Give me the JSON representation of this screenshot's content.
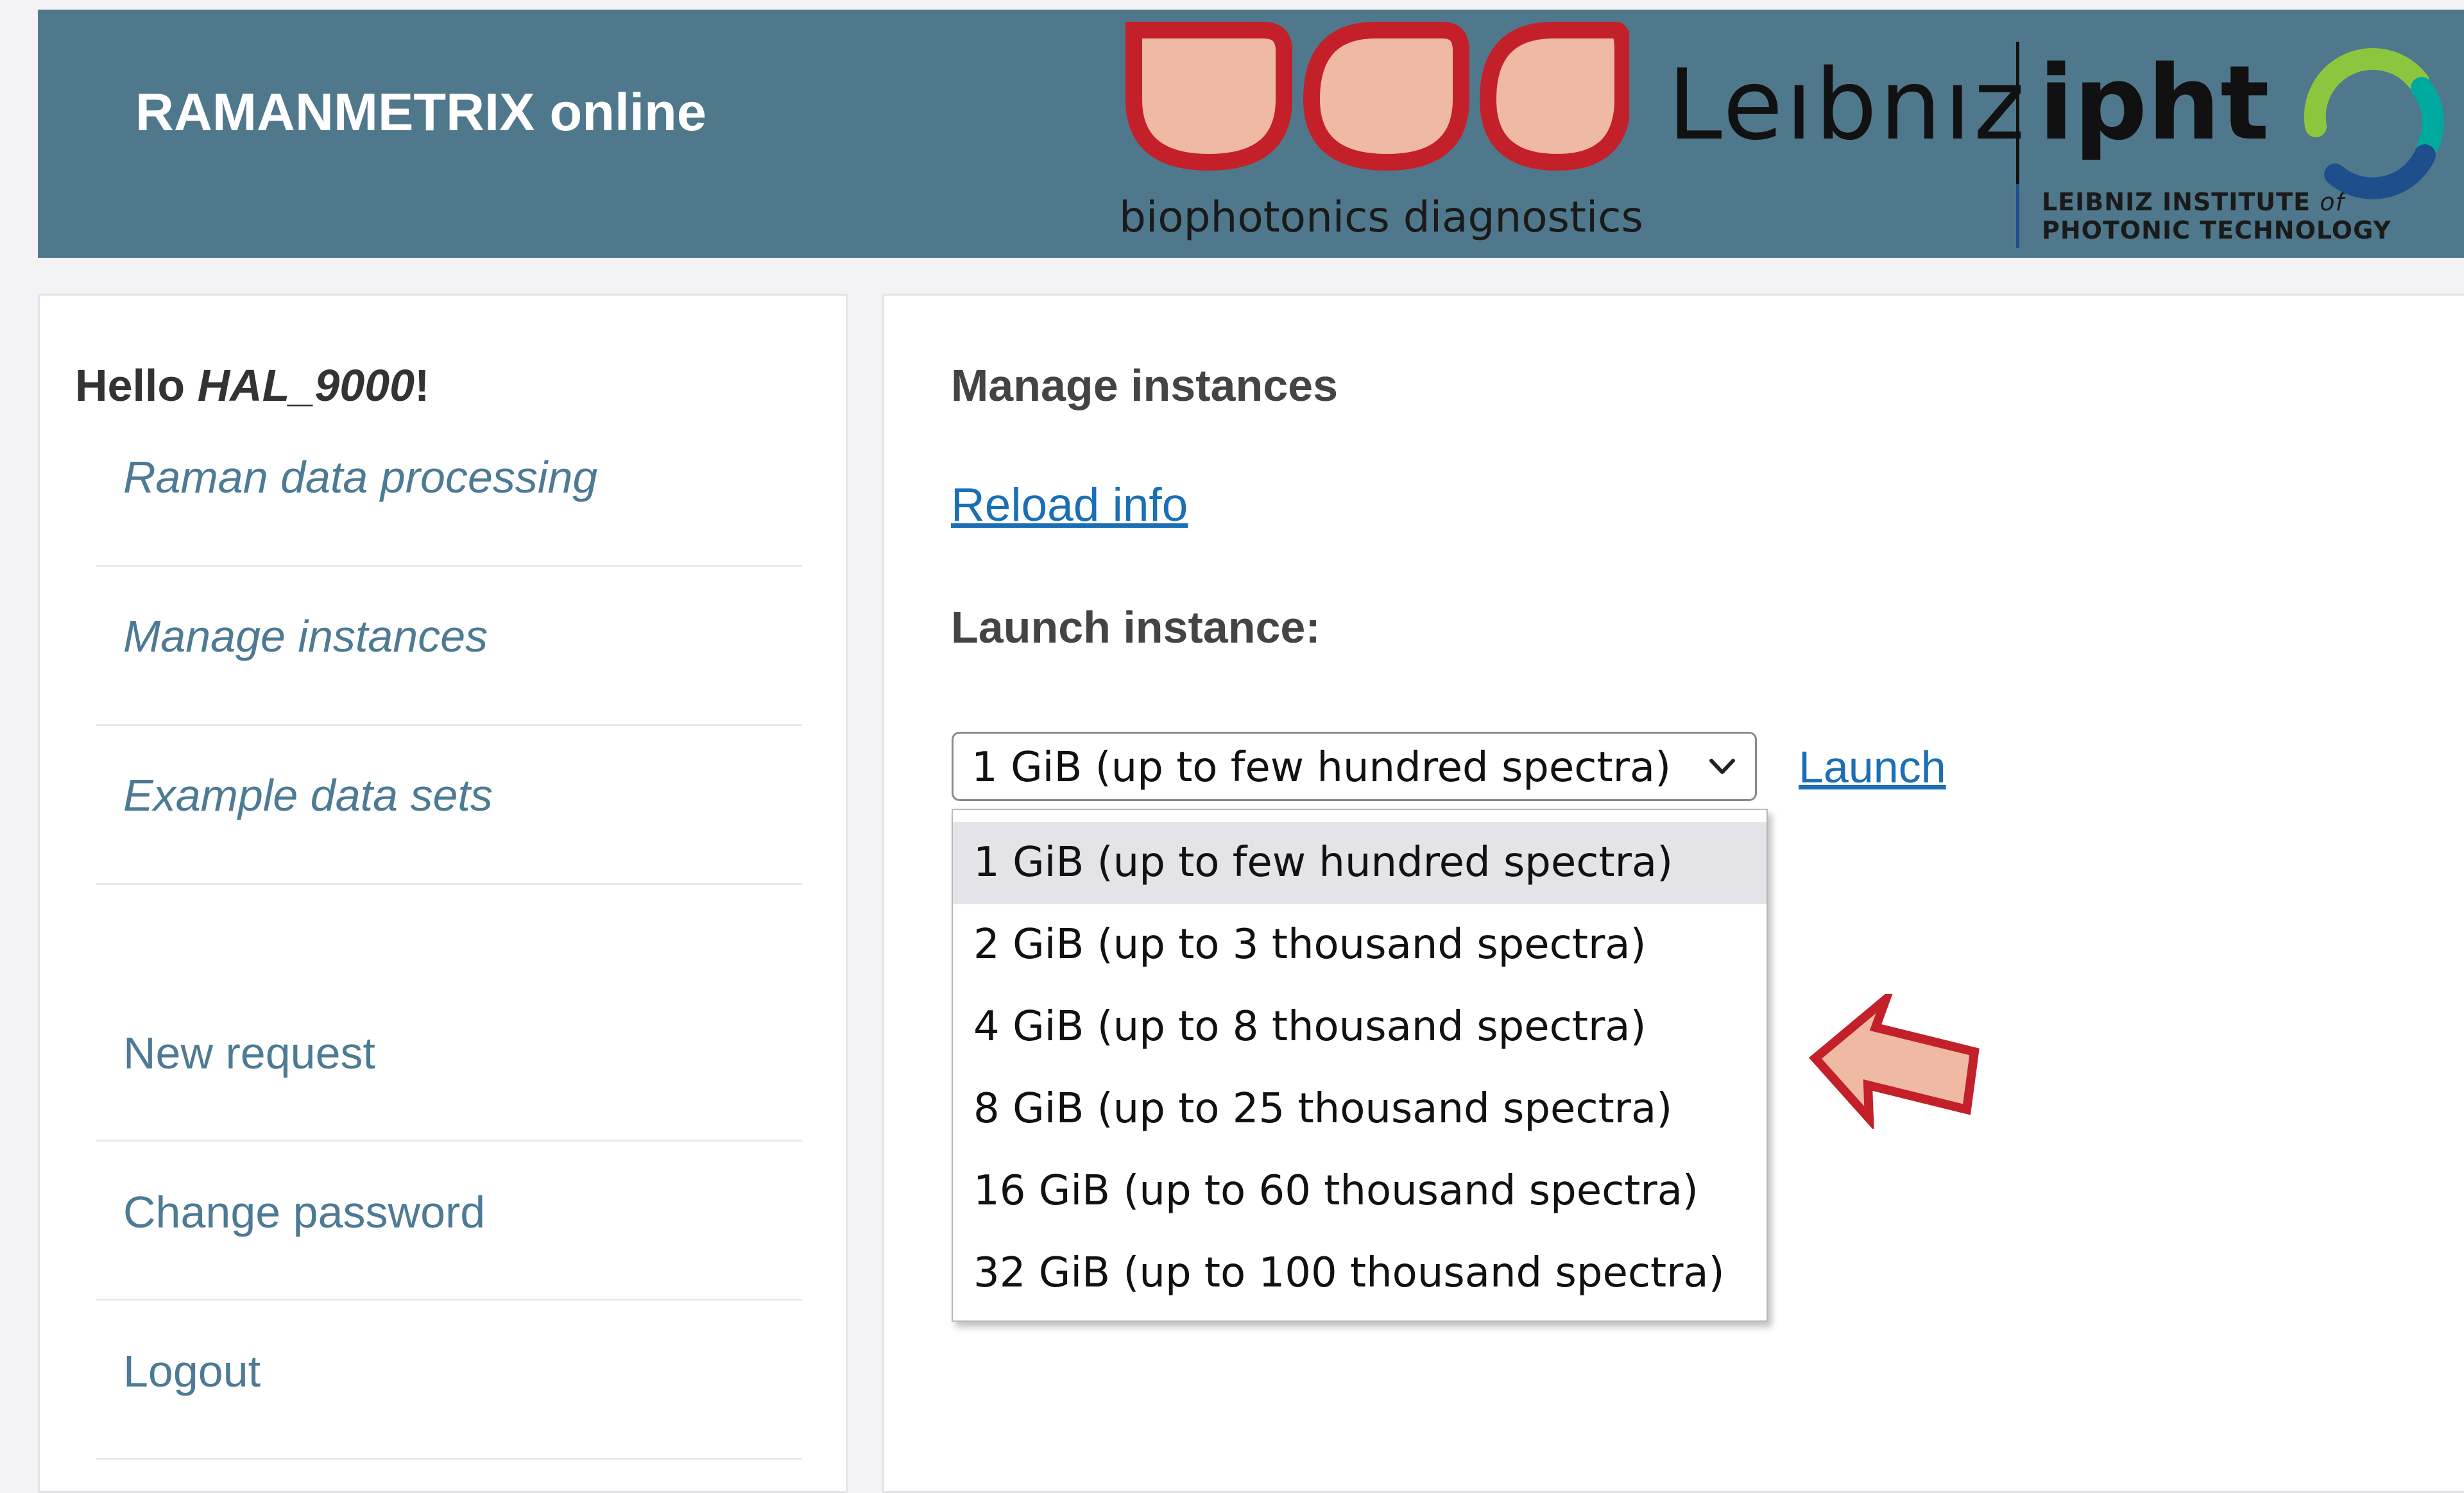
{
  "header": {
    "brand_bold": "RAMANMETRIX",
    "brand_rest": " online",
    "bpd_caption": "biophotonics diagnostics",
    "leibniz": "Leıbnız",
    "ipht": "ipht",
    "ipht_sub_line1a": "LEIBNIZ INSTITUTE ",
    "ipht_sub_of": "of",
    "ipht_sub_line2": "PHOTONIC TECHNOLOGY",
    "colors": {
      "bar": "#50788c",
      "bpd_red": "#c3202a",
      "bpd_fill": "#f0b9a4"
    }
  },
  "sidebar": {
    "hello_prefix": "Hello ",
    "hello_user": "HAL_9000",
    "hello_suffix": "!",
    "items": [
      {
        "label": "Raman data processing"
      },
      {
        "label": "Manage instances"
      },
      {
        "label": "Example data sets"
      },
      {
        "label": "New request"
      },
      {
        "label": "Change password"
      },
      {
        "label": "Logout"
      }
    ]
  },
  "main": {
    "title": "Manage instances",
    "reload_link": "Reload info",
    "launch_heading": "Launch instance:",
    "select_value": "1 GiB (up to few hundred spectra)",
    "launch_link": "Launch",
    "options": [
      "1 GiB (up to few hundred spectra)",
      "2 GiB (up to 3 thousand spectra)",
      "4 GiB (up to 8 thousand spectra)",
      "8 GiB (up to 25 thousand spectra)",
      "16 GiB (up to 60 thousand spectra)",
      "32 GiB (up to 100 thousand spectra)"
    ]
  },
  "annotation": {
    "arrow_icon": "left-arrow-icon",
    "color": "#c3202a"
  }
}
